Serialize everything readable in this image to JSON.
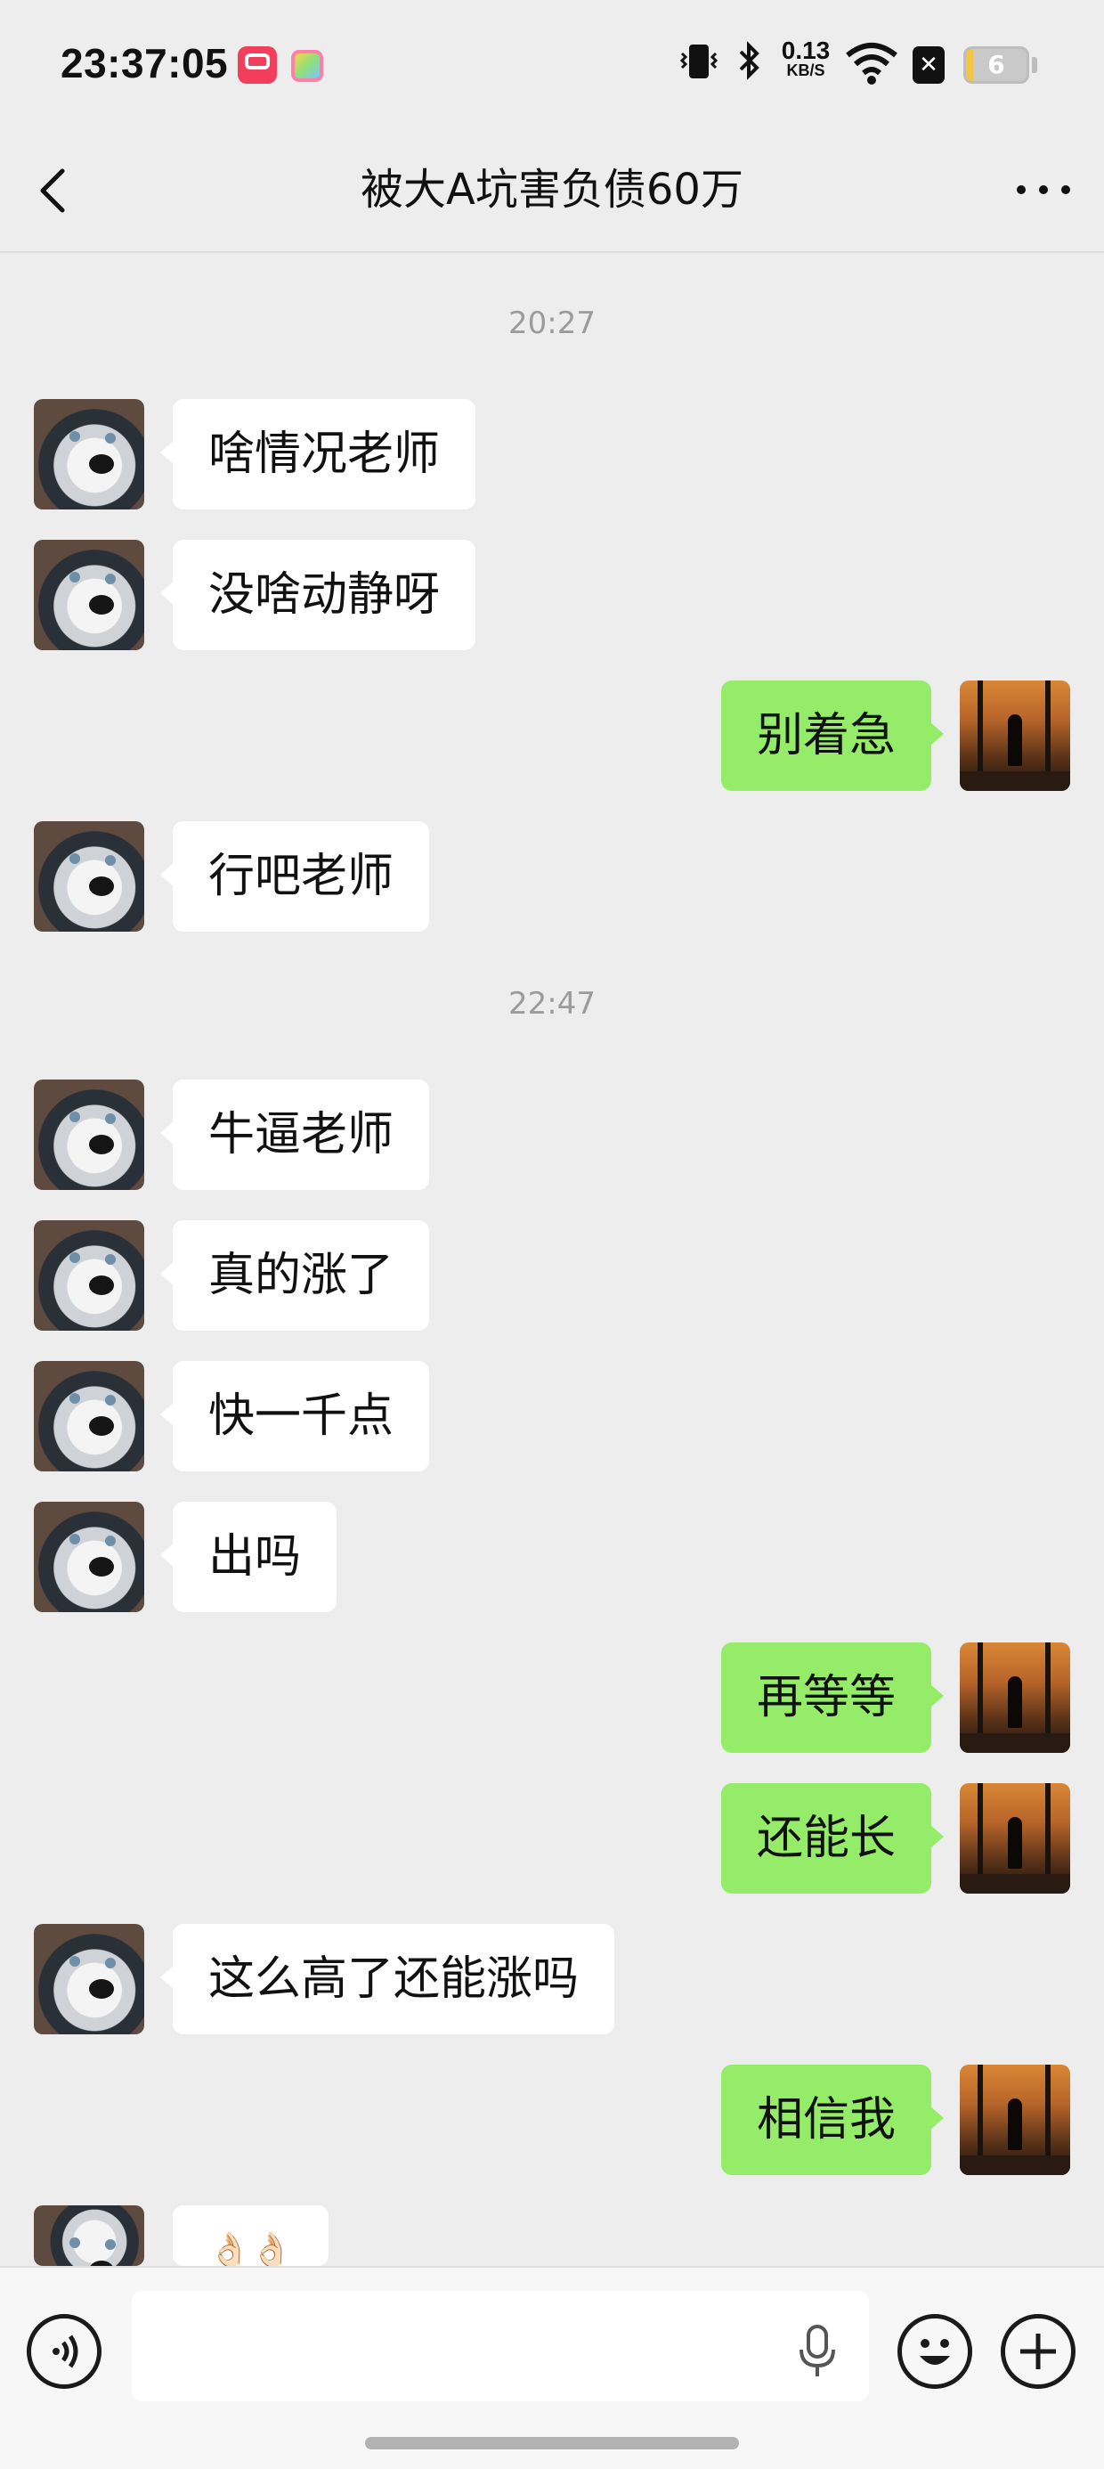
{
  "status_bar": {
    "time": "23:37:05",
    "net_speed_value": "0.13",
    "net_speed_unit": "KB/S",
    "battery": "6",
    "sim_glyph": "✕"
  },
  "header": {
    "title": "被大A坑害负债60万"
  },
  "messages": [
    {
      "type": "timestamp",
      "text": "20:27"
    },
    {
      "side": "in",
      "text": "啥情况老师"
    },
    {
      "side": "in",
      "text": "没啥动静呀"
    },
    {
      "side": "out",
      "text": "别着急"
    },
    {
      "side": "in",
      "text": "行吧老师"
    },
    {
      "type": "timestamp",
      "text": "22:47"
    },
    {
      "side": "in",
      "text": "牛逼老师"
    },
    {
      "side": "in",
      "text": "真的涨了"
    },
    {
      "side": "in",
      "text": "快一千点"
    },
    {
      "side": "in",
      "text": "出吗"
    },
    {
      "side": "out",
      "text": "再等等"
    },
    {
      "side": "out",
      "text": "还能长"
    },
    {
      "side": "in",
      "text": "这么高了还能涨吗"
    },
    {
      "side": "out",
      "text": "相信我"
    },
    {
      "side": "in",
      "text": "👌🏻👌🏻"
    }
  ],
  "colors": {
    "background": "#ededed",
    "outgoing_bubble": "#95ec69",
    "incoming_bubble": "#ffffff"
  },
  "input_bar": {
    "value": ""
  }
}
